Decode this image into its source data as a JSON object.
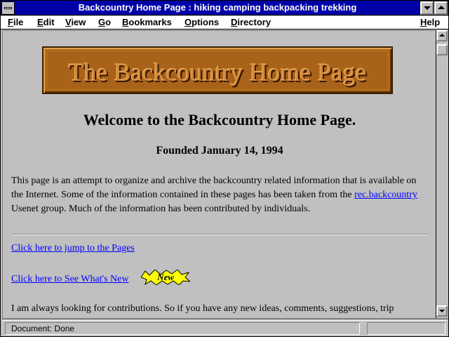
{
  "window": {
    "title": "Backcountry Home Page : hiking camping backpacking trekking"
  },
  "menubar": {
    "items": [
      "File",
      "Edit",
      "View",
      "Go",
      "Bookmarks",
      "Options",
      "Directory"
    ],
    "help": "Help"
  },
  "page": {
    "logo_text": "The Backcountry Home Page",
    "heading": "Welcome to the Backcountry Home Page.",
    "subheading": "Founded January 14, 1994",
    "intro_before_link": "This page is an attempt to organize and archive the backcountry related information that is available on the Internet. Some of the information contained in these pages has been taken from the ",
    "intro_link": "rec.backcountry",
    "intro_after_link": " Usenet group. Much of the information has been contributed by individuals.",
    "link_pages": "Click here to jump to the Pages",
    "link_whats_new": "Click here to See What's New",
    "new_badge": "New",
    "cut_off_text": "I am always looking for contributions. So if you have any new ideas, comments, suggestions, trip"
  },
  "status": {
    "text": "Document: Done"
  },
  "colors": {
    "titlebar": "#0000a8",
    "link": "#0000ff",
    "logo_bg": "#b06a1c",
    "badge": "#ffff00"
  }
}
